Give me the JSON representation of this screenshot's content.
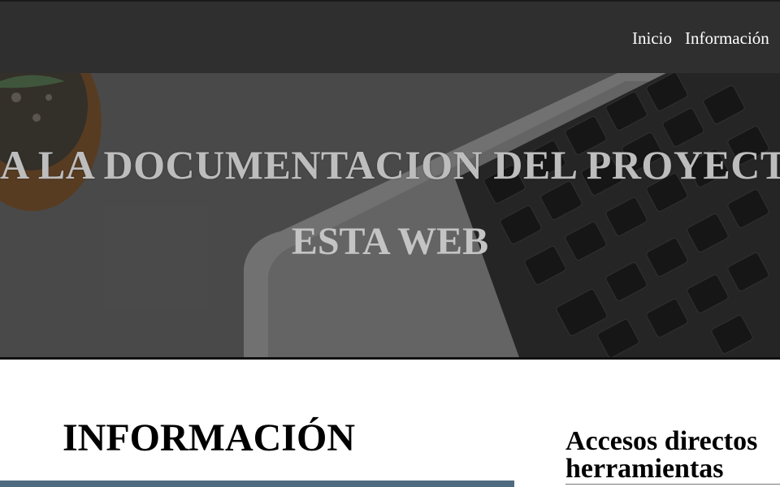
{
  "nav": {
    "items": [
      "Inicio",
      "Información"
    ]
  },
  "hero": {
    "title": "A LA DOCUMENTACION DEL PROYECTO",
    "subtitle": "ESTA WEB"
  },
  "main": {
    "heading": "INFORMACIÓN"
  },
  "sidebar": {
    "heading": "Accesos directos herramientas"
  }
}
